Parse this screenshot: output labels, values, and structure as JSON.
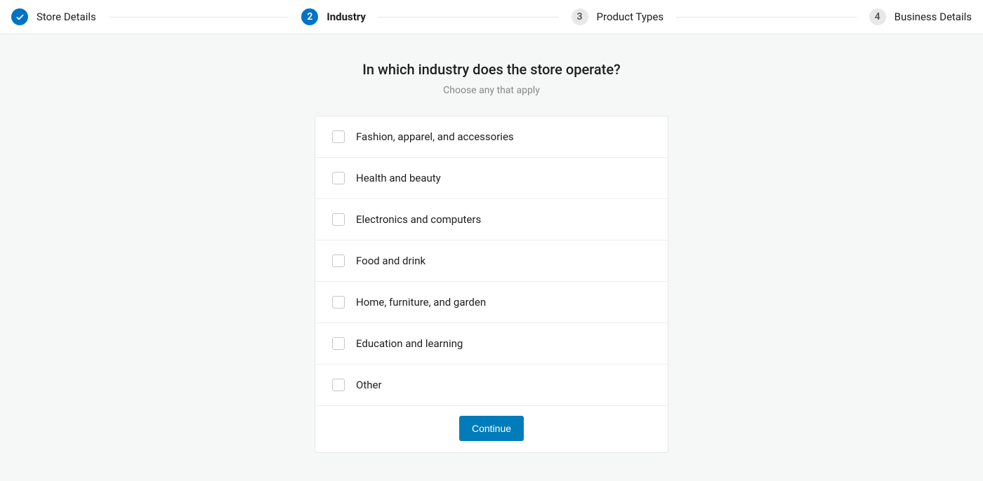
{
  "stepper": {
    "steps": [
      {
        "label": "Store Details",
        "status": "completed",
        "number": ""
      },
      {
        "label": "Industry",
        "status": "current",
        "number": "2"
      },
      {
        "label": "Product Types",
        "status": "upcoming",
        "number": "3"
      },
      {
        "label": "Business Details",
        "status": "upcoming",
        "number": "4"
      }
    ]
  },
  "question": {
    "title": "In which industry does the store operate?",
    "subtitle": "Choose any that apply"
  },
  "options": [
    {
      "label": "Fashion, apparel, and accessories"
    },
    {
      "label": "Health and beauty"
    },
    {
      "label": "Electronics and computers"
    },
    {
      "label": "Food and drink"
    },
    {
      "label": "Home, furniture, and garden"
    },
    {
      "label": "Education and learning"
    },
    {
      "label": "Other"
    }
  ],
  "actions": {
    "continue_label": "Continue"
  }
}
